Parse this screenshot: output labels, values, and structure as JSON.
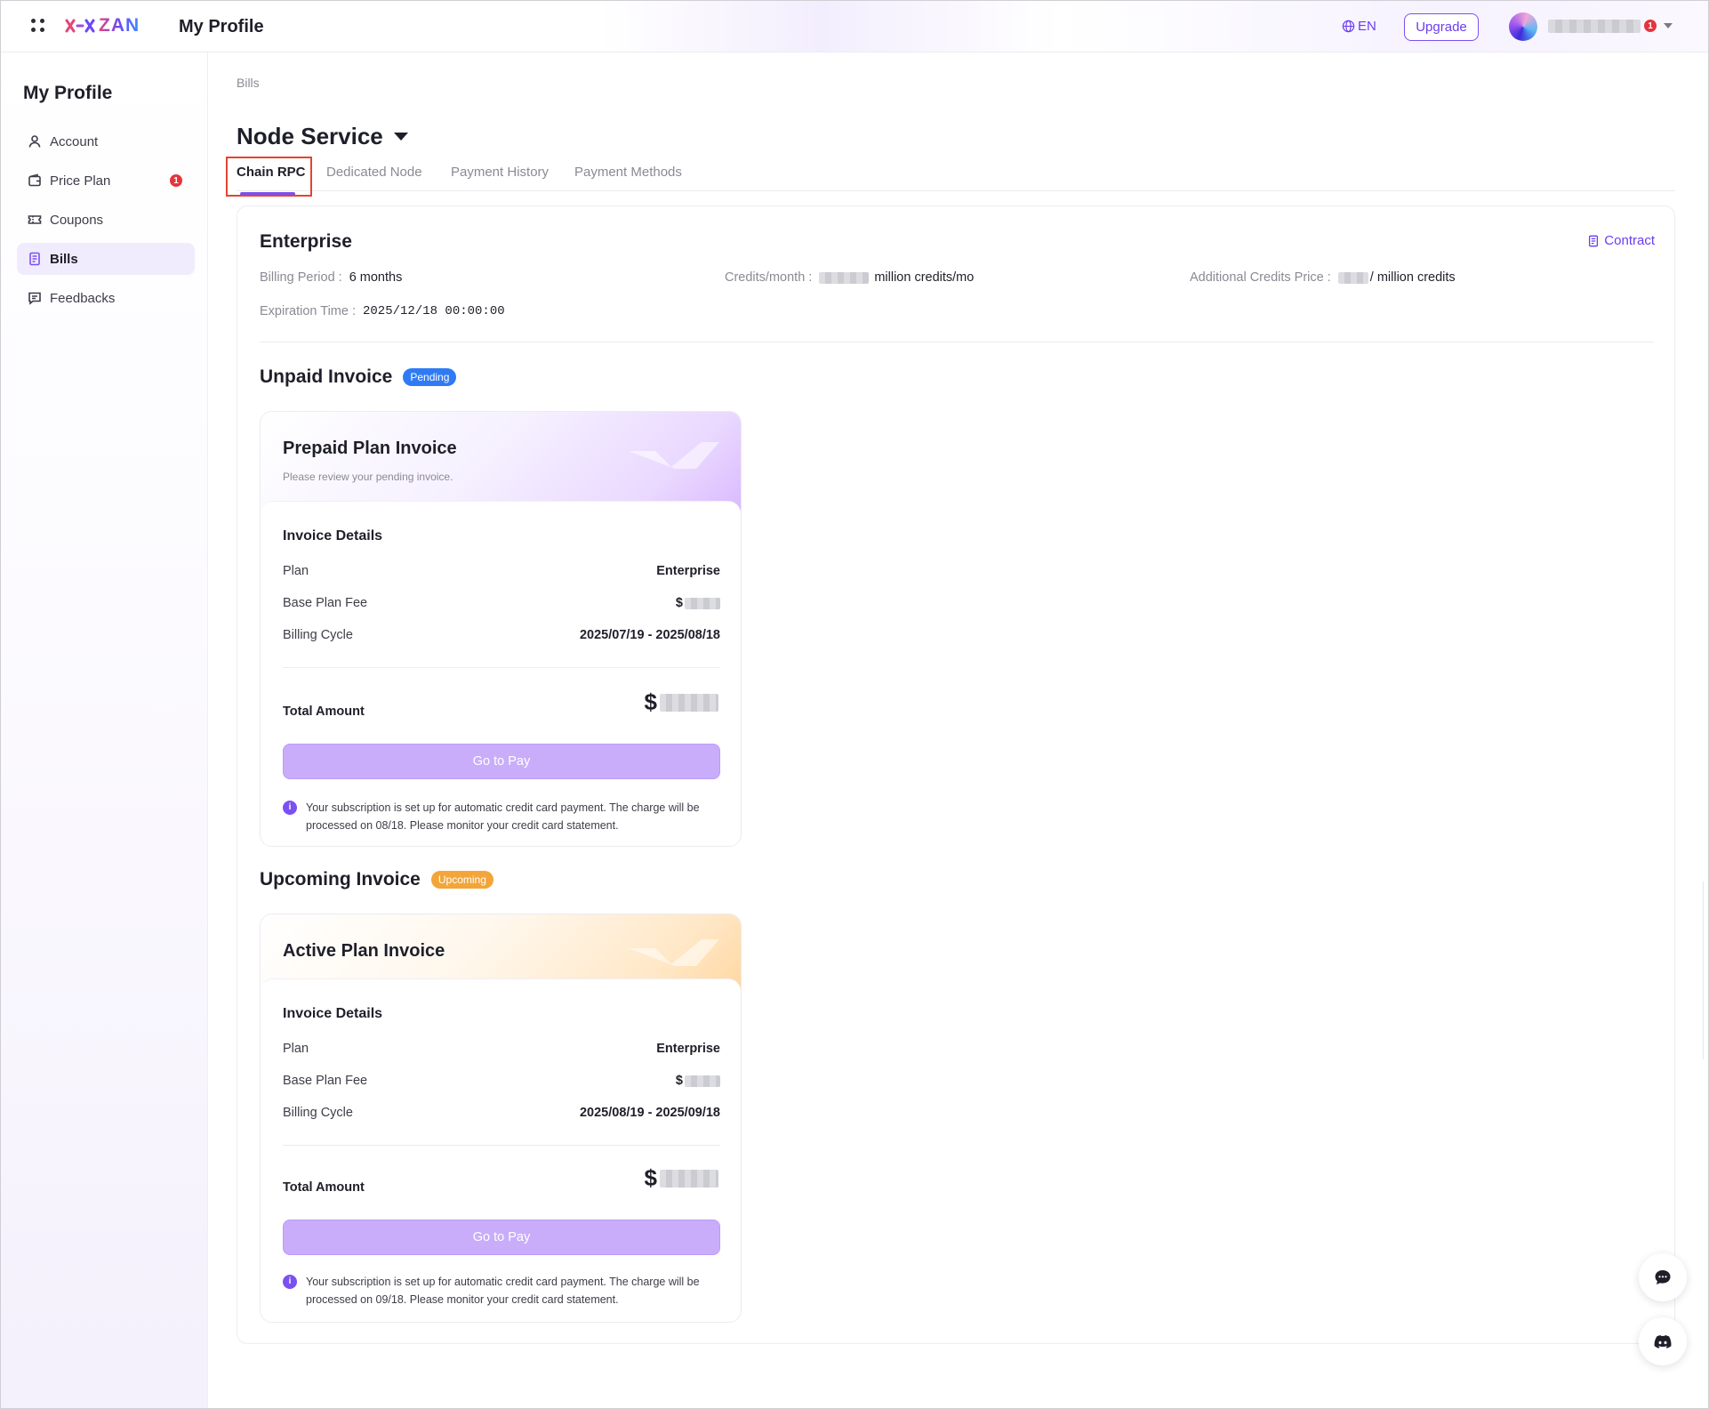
{
  "app": {
    "logo_text": "ZAN",
    "title": "My Profile"
  },
  "topbar": {
    "language": "EN",
    "upgrade_label": "Upgrade",
    "notification_count": "1"
  },
  "sidebar": {
    "title": "My Profile",
    "items": [
      {
        "label": "Account",
        "icon": "user-icon"
      },
      {
        "label": "Price Plan",
        "icon": "wallet-icon",
        "badge": "1"
      },
      {
        "label": "Coupons",
        "icon": "ticket-icon"
      },
      {
        "label": "Bills",
        "icon": "document-icon",
        "active": true
      },
      {
        "label": "Feedbacks",
        "icon": "message-icon"
      }
    ]
  },
  "breadcrumb": "Bills",
  "service": {
    "title": "Node Service"
  },
  "tabs": [
    {
      "label": "Chain RPC",
      "active": true
    },
    {
      "label": "Dedicated Node"
    },
    {
      "label": "Payment History"
    },
    {
      "label": "Payment Methods"
    }
  ],
  "plan": {
    "name": "Enterprise",
    "contract_label": "Contract",
    "billing_period_label": "Billing Period :",
    "billing_period_value": "6 months",
    "credits_label": "Credits/month :",
    "credits_suffix": "million credits/mo",
    "additional_label": "Additional Credits Price :",
    "additional_suffix": "/ million credits",
    "expiration_label": "Expiration Time :",
    "expiration_value": "2025/12/18 00:00:00"
  },
  "unpaid": {
    "section_title": "Unpaid Invoice",
    "status": "Pending",
    "card_title": "Prepaid Plan Invoice",
    "card_subtitle": "Please review your pending invoice.",
    "details_title": "Invoice Details",
    "plan_label": "Plan",
    "plan_value": "Enterprise",
    "fee_label": "Base Plan Fee",
    "fee_prefix": "$",
    "cycle_label": "Billing Cycle",
    "cycle_value": "2025/07/19 - 2025/08/18",
    "total_label": "Total Amount",
    "total_prefix": "$",
    "pay_label": "Go to Pay",
    "note": "Your subscription is set up for automatic credit card payment. The charge will be processed on 08/18. Please monitor your credit card statement."
  },
  "upcoming": {
    "section_title": "Upcoming Invoice",
    "status": "Upcoming",
    "card_title": "Active Plan Invoice",
    "details_title": "Invoice Details",
    "plan_label": "Plan",
    "plan_value": "Enterprise",
    "fee_label": "Base Plan Fee",
    "fee_prefix": "$",
    "cycle_label": "Billing Cycle",
    "cycle_value": "2025/08/19 - 2025/09/18",
    "total_label": "Total Amount",
    "total_prefix": "$",
    "pay_label": "Go to Pay",
    "note": "Your subscription is set up for automatic credit card payment. The charge will be processed on 09/18. Please monitor your credit card statement."
  },
  "colors": {
    "accent": "#7b50f2",
    "pending": "#2f7bf5",
    "upcoming": "#f3a53a",
    "badge": "#e5343c"
  }
}
